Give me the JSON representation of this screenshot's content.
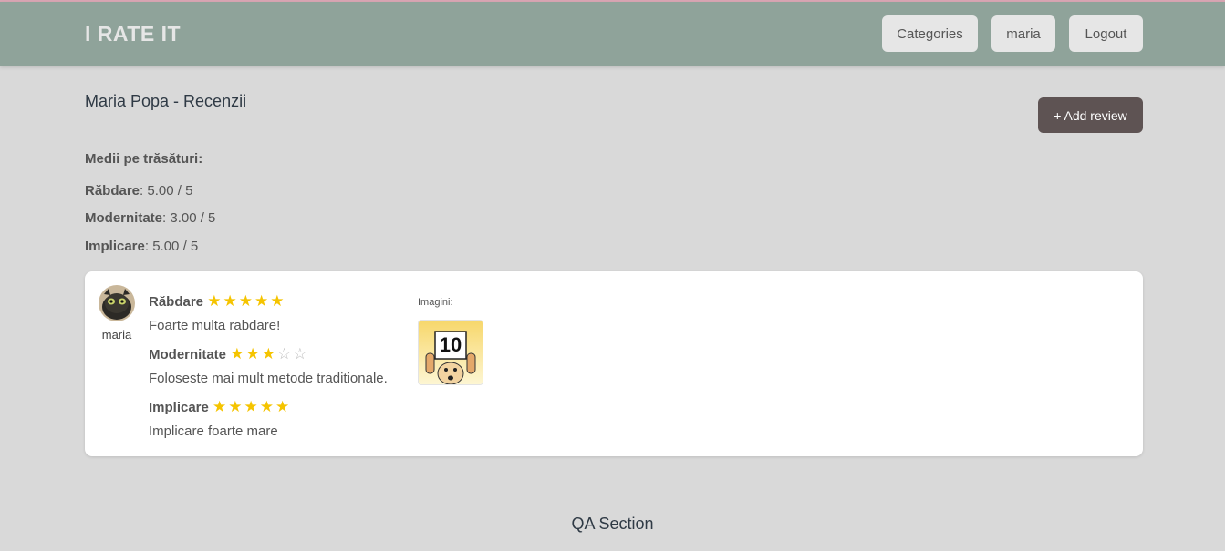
{
  "brand": "I RATE IT",
  "nav": {
    "categories": "Categories",
    "user": "maria",
    "logout": "Logout"
  },
  "page_title": "Maria Popa - Recenzii",
  "add_review": "+ Add review",
  "averages": {
    "heading": "Medii pe trăsături:",
    "items": [
      {
        "name": "Răbdare",
        "value": ": 5.00 / 5"
      },
      {
        "name": "Modernitate",
        "value": ": 3.00 / 5"
      },
      {
        "name": "Implicare",
        "value": ": 5.00 / 5"
      }
    ]
  },
  "review": {
    "author": "maria",
    "traits": [
      {
        "name": "Răbdare",
        "rating": 5,
        "comment": "Foarte multa rabdare!"
      },
      {
        "name": "Modernitate",
        "rating": 3,
        "comment": "Foloseste mai mult metode traditionale."
      },
      {
        "name": "Implicare",
        "rating": 5,
        "comment": "Implicare foarte mare"
      }
    ],
    "images_label": "Imagini:",
    "image_text": "10"
  },
  "qa_title": "QA Section",
  "colors": {
    "header": "#8fa39a",
    "background": "#d9d9d9",
    "add_button": "#5e5353",
    "star": "#f5c400"
  }
}
